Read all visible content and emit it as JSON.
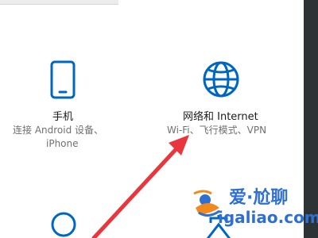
{
  "colors": {
    "accent": "#0067c0",
    "arrow": "#e8363c",
    "watermark_blue": "#2f6fd0",
    "watermark_orange": "#f08a1c"
  },
  "tiles": [
    {
      "id": "phone",
      "icon": "phone-icon",
      "title": "手机",
      "desc_lines": [
        "连接 Android 设备、",
        "iPhone"
      ]
    },
    {
      "id": "network",
      "icon": "globe-icon",
      "title": "网络和 Internet",
      "desc_lines": [
        "Wi-Fi、飞行模式、VPN"
      ]
    },
    {
      "id": "accounts",
      "icon": "person-icon",
      "title": "",
      "desc_lines": []
    },
    {
      "id": "time-language",
      "icon": "language-icon",
      "title": "",
      "desc_lines": []
    }
  ],
  "watermark": {
    "brand_zh": "爱·尬聊",
    "brand_en": "igaliao.com"
  }
}
